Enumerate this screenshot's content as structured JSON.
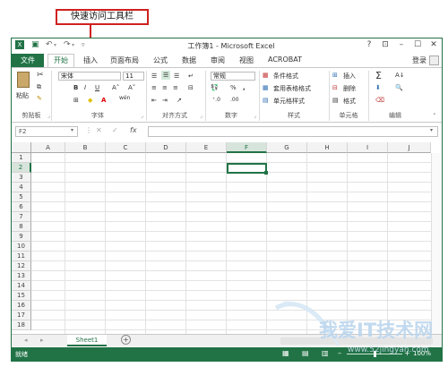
{
  "annotation": {
    "label": "快速访问工具栏"
  },
  "window": {
    "title": "工作簿1 - Microsoft Excel",
    "login": "登录"
  },
  "tabs": [
    "文件",
    "开始",
    "插入",
    "页面布局",
    "公式",
    "数据",
    "审阅",
    "视图",
    "ACROBAT"
  ],
  "ribbon": {
    "clipboard": {
      "paste": "粘贴",
      "group": "剪贴板"
    },
    "font": {
      "name": "宋体",
      "size": "11",
      "bold": "B",
      "italic": "I",
      "underline": "U",
      "grow": "A˄",
      "shrink": "A˅",
      "group": "字体",
      "wen": "wén"
    },
    "alignment": {
      "group": "对齐方式"
    },
    "number": {
      "format": "常规",
      "percent": "%",
      "comma": ",",
      "group": "数字"
    },
    "styles": {
      "conditional": "条件格式",
      "table": "套用表格格式",
      "cell": "单元格样式",
      "group": "样式"
    },
    "cells": {
      "insert": "插入",
      "delete": "删除",
      "format": "格式",
      "group": "单元格"
    },
    "editing": {
      "sum": "Σ",
      "group": "编辑"
    }
  },
  "formula_bar": {
    "name_box": "F2",
    "fx": "fx"
  },
  "grid": {
    "columns": [
      "A",
      "B",
      "C",
      "D",
      "E",
      "F",
      "G",
      "H",
      "I",
      "J"
    ],
    "rows": [
      "1",
      "2",
      "3",
      "4",
      "5",
      "6",
      "7",
      "8",
      "9",
      "10",
      "11",
      "12",
      "13",
      "14",
      "15",
      "16",
      "17",
      "18"
    ],
    "active_cell": "F2"
  },
  "sheets": {
    "active": "Sheet1",
    "add": "+"
  },
  "status": {
    "ready": "就绪",
    "zoom": "100%"
  },
  "watermark": {
    "text": "我爱IT技术网",
    "url": "www.52jingyan.com"
  },
  "colors": {
    "accent": "#217346",
    "annotation": "#d02020"
  }
}
